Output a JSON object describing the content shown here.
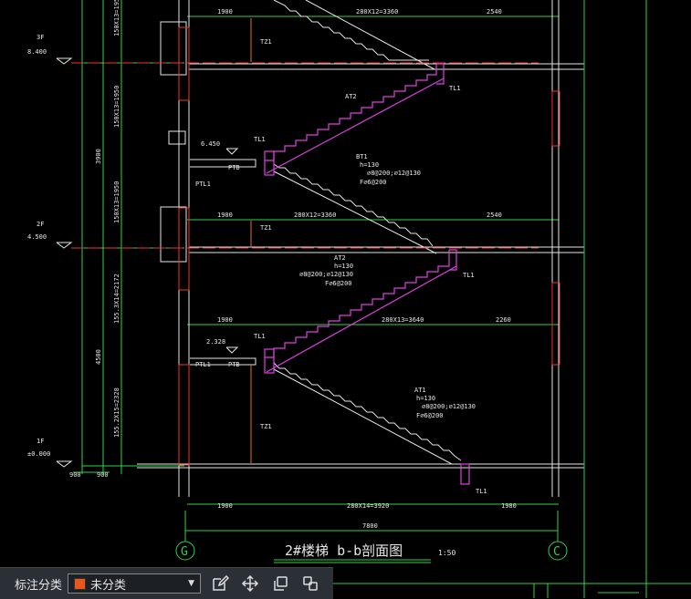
{
  "drawing": {
    "title": "2#楼梯 b-b剖面图",
    "scale": "1:50",
    "axis_left": "G",
    "axis_right": "C",
    "levels": [
      {
        "floor": "3F",
        "elev": "8.400"
      },
      {
        "floor": "2F",
        "elev": "4.500"
      },
      {
        "floor": "1F",
        "elev": "±0.000"
      }
    ],
    "landing_levels": [
      "6.450",
      "2.328"
    ],
    "dims_top": [
      "1900",
      "280X12=3360",
      "2540"
    ],
    "dims_mid": [
      "1900",
      "280X12=3360",
      "2540"
    ],
    "dims_low": [
      "1900",
      "280X13=3640",
      "2260"
    ],
    "dims_bottom": [
      "1900",
      "280X14=3920",
      "1980"
    ],
    "total_width": "7800",
    "vertical_dims": [
      "150X13=1950",
      "150X13=1950",
      "155.3X14=2172",
      "155.2X15=2328",
      "3900",
      "4500",
      "900",
      "900"
    ],
    "member_labels": {
      "tl": "TL1",
      "tz": "TZ1",
      "ptl": "PTL1",
      "ptb": "PTB",
      "at2": "AT2",
      "at1": "AT1",
      "bt": "BT1"
    },
    "stair_notes": {
      "bt1": [
        "BT1",
        "h=130",
        "⌀8@200;⌀12@130",
        "F⌀6@200"
      ],
      "at2": [
        "AT2",
        "h=130",
        "⌀8@200;⌀12@130",
        "F⌀6@200"
      ],
      "at1": [
        "AT1",
        "h=130",
        "⌀8@200;⌀12@130",
        "F⌀6@200"
      ]
    }
  },
  "toolbar": {
    "label": "标注分类",
    "category_value": "未分类",
    "category_color": "#e8561c",
    "buttons": [
      "edit-icon",
      "move-icon",
      "copy-icon",
      "copy-multiple-icon"
    ]
  }
}
